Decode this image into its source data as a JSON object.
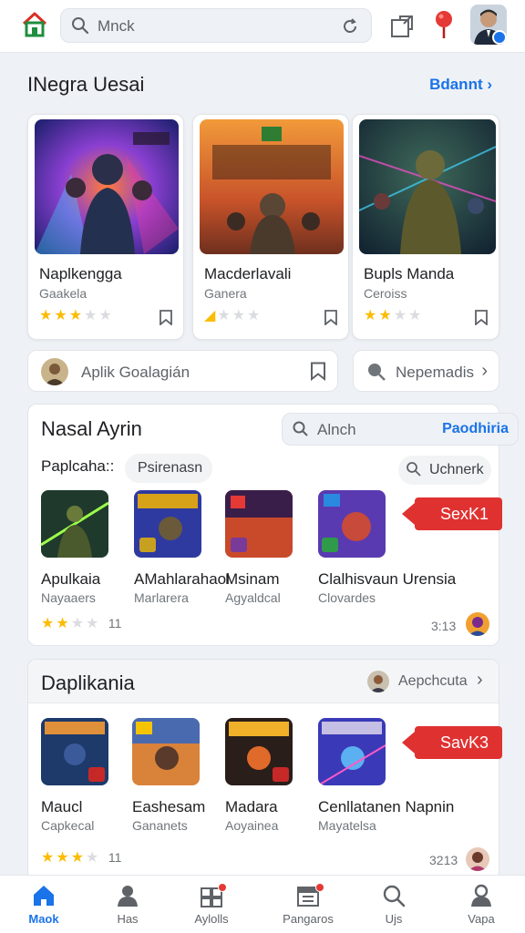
{
  "topbar": {
    "search_text": "Mnck",
    "icons": [
      "home-icon",
      "search-icon",
      "refresh-icon",
      "share-icon",
      "location-pin-icon",
      "avatar"
    ]
  },
  "section1": {
    "title": "INegra Uesai",
    "link": "Bdannt",
    "cards": [
      {
        "title": "Naplkengga",
        "subtitle": "Gaakela",
        "rating": 3.5
      },
      {
        "title": "Macderlavali",
        "subtitle": "Ganera",
        "rating": 0.5
      },
      {
        "title": "Bupls Manda",
        "subtitle": "Ceroiss",
        "rating": 2
      }
    ],
    "pill_left": "Aplik Goalagián",
    "pill_right": "Nepemadis"
  },
  "panel1": {
    "title": "Nasal Ayrin",
    "search_text": "Alnch",
    "search_link": "Paodhiria",
    "filter_label": "Paplcaha::",
    "chip_left": "Psirenasn",
    "chip_right": "Uchnerk",
    "tag": "SexK1",
    "apps": [
      {
        "title": "Apulkaia",
        "subtitle": "Nayaaers"
      },
      {
        "title": "AMahlarahaol",
        "subtitle": "Marlarera"
      },
      {
        "title": "Msinam",
        "subtitle": "Agyaldcal"
      },
      {
        "title": "Clalhisvaun Urensia",
        "subtitle": "Clovardes"
      }
    ],
    "rating": 2,
    "rating_count": "11",
    "time": "3:13"
  },
  "panel2": {
    "title": "Daplikania",
    "author": "Aepchcuta",
    "tag": "SavK3",
    "apps": [
      {
        "title": "Maucl",
        "subtitle": "Capkecal"
      },
      {
        "title": "Eashesam",
        "subtitle": "Gananets"
      },
      {
        "title": "Madara",
        "subtitle": "Aoyainea"
      },
      {
        "title": "Cenllatanen Napnin",
        "subtitle": "Mayatelsa"
      }
    ],
    "rating": 3,
    "rating_count": "11",
    "time": "3213"
  },
  "bottomnav": [
    {
      "label": "Maok",
      "icon": "home-icon",
      "active": true
    },
    {
      "label": "Has",
      "icon": "person-icon",
      "active": false
    },
    {
      "label": "Aylolls",
      "icon": "apps-icon",
      "active": false
    },
    {
      "label": "Pangaros",
      "icon": "calendar-icon",
      "active": false
    },
    {
      "label": "Ujs",
      "icon": "search-icon",
      "active": false
    },
    {
      "label": "Vapa",
      "icon": "account-icon",
      "active": false
    }
  ],
  "colors": {
    "accent": "#1a73e8",
    "tag_red": "#e03131",
    "star": "#fbbc04"
  }
}
